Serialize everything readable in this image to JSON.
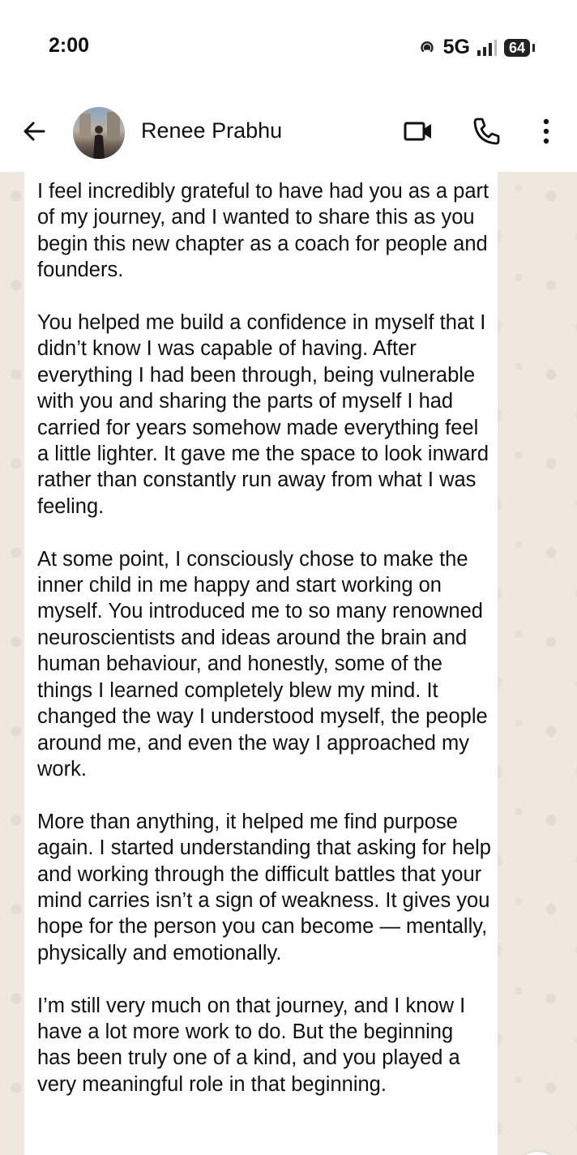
{
  "status_bar": {
    "time": "2:00",
    "network": "5G",
    "battery": "64"
  },
  "header": {
    "contact_name": "Renee Prabhu",
    "icons": [
      "back-arrow-icon",
      "video-call-icon",
      "voice-call-icon",
      "more-options-icon"
    ]
  },
  "message": {
    "paragraphs": [
      "I feel incredibly grateful to have had you as a part of my journey, and I wanted to share this as you begin this new chapter as a coach for people and founders.",
      "You helped me build a confidence in myself that I didn’t know I was capable of having. After everything I had been through, being vulnerable with you and sharing the parts of myself I had carried for years somehow made everything feel a little lighter. It gave me the space to look inward rather than constantly run away from what I was feeling.",
      "At some point, I consciously chose to make the inner child in me happy and start working on myself. You introduced me to so many renowned neuroscientists and ideas around the brain and human behaviour, and honestly, some of the things I learned completely blew my mind. It changed the way I understood myself, the people around me, and even the way I approached my work.",
      "More than anything, it helped me find purpose again. I started understanding that asking for help and working through the difficult battles that your mind carries isn’t a sign of weakness. It gives you hope for the person you can become — mentally, physically and emotionally.",
      "I’m still very much on that journey, and I know I have a lot more work to do. But the beginning has been truly one of a kind, and you played a very meaningful role in that beginning."
    ]
  },
  "colors": {
    "chat_background": "#efe8df",
    "bubble": "#ffffff",
    "text": "#111111"
  }
}
